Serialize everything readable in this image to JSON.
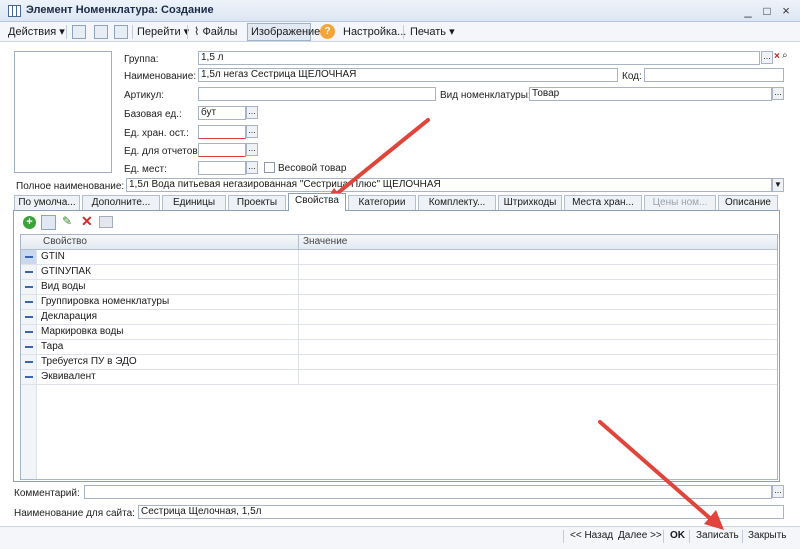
{
  "window": {
    "title": "Элемент Номенклатура: Создание"
  },
  "toolbar": {
    "actions": "Действия",
    "goto": "Перейти",
    "files": "Файлы",
    "image": "Изображение",
    "settings": "Настройка...",
    "print": "Печать"
  },
  "form": {
    "group_label": "Группа:",
    "group_value": "1,5 л",
    "name_label": "Наименование:",
    "name_value": "1,5л негаз Сестрица ЩЕЛОЧНАЯ",
    "code_label": "Код:",
    "code_value": "",
    "article_label": "Артикул:",
    "article_value": "",
    "kind_label": "Вид номенклатуры:",
    "kind_value": "Товар",
    "base_unit_label": "Базовая ед.:",
    "base_unit_value": "бут",
    "storage_unit_label": "Ед. хран. ост.:",
    "storage_unit_value": "",
    "report_unit_label": "Ед. для отчетов:",
    "report_unit_value": "",
    "place_unit_label": "Ед. мест:",
    "place_unit_value": "",
    "weight_label": "Весовой товар",
    "full_name_label": "Полное наименование:",
    "full_name_value": "1,5л Вода питьевая негазированная \"Сестрица Плюс\" ЩЕЛОЧНАЯ",
    "comment_label": "Комментарий:",
    "comment_value": "",
    "site_name_label": "Наименование для сайта:",
    "site_name_value": "Сестрица Щелочная, 1,5л"
  },
  "tabs": [
    "По умолча...",
    "Дополните...",
    "Единицы",
    "Проекты",
    "Свойства",
    "Категории",
    "Комплекту...",
    "Штрихкоды",
    "Места хран...",
    "Цены ном...",
    "Описание"
  ],
  "grid": {
    "col_property": "Свойство",
    "col_value": "Значение",
    "rows": [
      "GTIN",
      "GTINУПАК",
      "Вид воды",
      "Группировка номенклатуры",
      "Декларация",
      "Маркировка воды",
      "Тара",
      "Требуется ПУ в ЭДО",
      "Эквивалент"
    ]
  },
  "bottom": {
    "back": "<< Назад",
    "next": "Далее >>",
    "ok": "OK",
    "save": "Записать",
    "close": "Закрыть"
  },
  "colors": {
    "accent_arrow": "#e0443a",
    "panel_border": "#8ea0b8"
  }
}
